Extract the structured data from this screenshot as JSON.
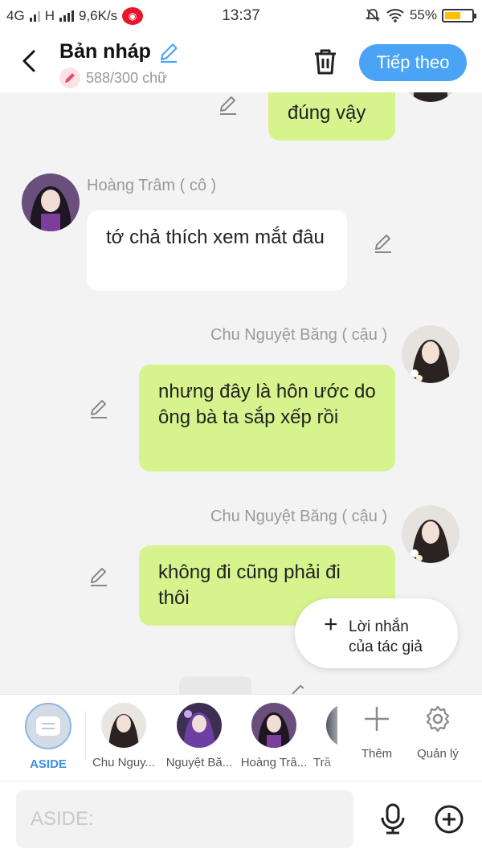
{
  "status_bar": {
    "network1": "4G",
    "network2": "H",
    "speed": "9,6K/s",
    "time": "13:37",
    "battery": "55%"
  },
  "header": {
    "title": "Bản nháp",
    "word_count": "588/300 chữ",
    "next_label": "Tiếp theo"
  },
  "messages": [
    {
      "sender": "",
      "side": "right",
      "text": "đúng vậy"
    },
    {
      "sender": "Hoàng Trâm ( cô )",
      "side": "left",
      "text": "tớ chả thích xem mắt đâu"
    },
    {
      "sender": "Chu Nguyệt Băng ( cậu )",
      "side": "right",
      "text": "nhưng đây là hôn ước do ông bà ta sắp xếp rồi"
    },
    {
      "sender": "Chu Nguyệt Băng ( cậu )",
      "side": "right",
      "text": "không đi cũng phải đi thôi"
    }
  ],
  "author_note": {
    "plus": "+",
    "label": "Lời nhắn của tác giả"
  },
  "characters": [
    {
      "label": "ASIDE"
    },
    {
      "label": "Chu Nguy..."
    },
    {
      "label": "Nguyệt Bă..."
    },
    {
      "label": "Hoàng Trâ..."
    },
    {
      "label": "Trầ"
    }
  ],
  "tools": {
    "add_label": "Thêm",
    "manage_label": "Quản lý"
  },
  "input": {
    "placeholder": "ASIDE:"
  },
  "colors": {
    "accent": "#4aa3f5",
    "bubble_green": "#d6f38d",
    "bubble_white": "#ffffff"
  },
  "icons": [
    "back-arrow-icon",
    "pencil-icon",
    "trash-icon",
    "edit-icon",
    "plus-icon",
    "gear-icon",
    "microphone-icon",
    "add-circle-icon"
  ]
}
